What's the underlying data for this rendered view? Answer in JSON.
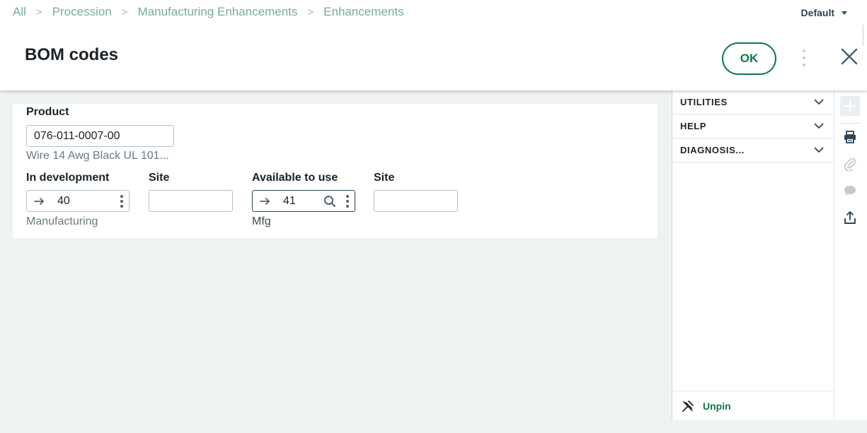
{
  "breadcrumb": {
    "items": [
      "All",
      "Procession",
      "Manufacturing Enhancements",
      "Enhancements"
    ],
    "separator": ">"
  },
  "header": {
    "default_label": "Default",
    "title": "BOM codes",
    "ok_label": "OK"
  },
  "form": {
    "product": {
      "label": "Product",
      "value": "076-011-0007-00",
      "description": "Wire 14 Awg Black UL 101..."
    },
    "in_development": {
      "label": "In development",
      "value": "40",
      "description": "Manufacturing"
    },
    "in_development_site": {
      "label": "Site",
      "value": ""
    },
    "available_to_use": {
      "label": "Available to use",
      "value": "41",
      "description": "Mfg"
    },
    "available_site": {
      "label": "Site",
      "value": ""
    }
  },
  "side_panel": {
    "sections": [
      {
        "label": "UTILITIES"
      },
      {
        "label": "HELP"
      },
      {
        "label": "DIAGNOSIS..."
      }
    ],
    "unpin_label": "Unpin"
  },
  "rail": {
    "icons": [
      "plus-icon",
      "print-icon",
      "paperclip-icon",
      "comment-icon",
      "share-icon"
    ]
  },
  "colors": {
    "accent": "#0b7a48",
    "breadcrumb": "#7aaa9c",
    "background": "#eff2f3"
  }
}
